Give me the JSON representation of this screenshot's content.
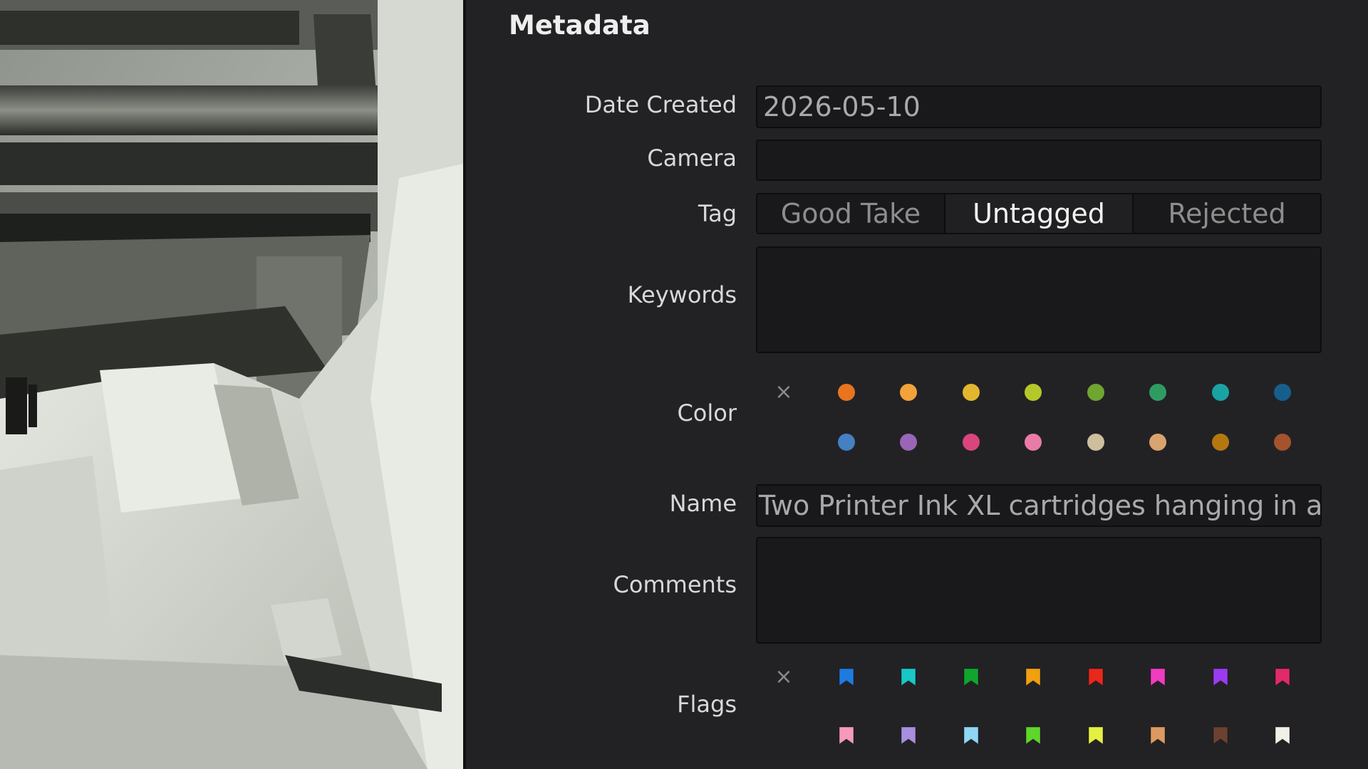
{
  "panel": {
    "title": "Metadata"
  },
  "fields": {
    "date_created": {
      "label": "Date Created",
      "value": "2026-05-10"
    },
    "camera": {
      "label": "Camera",
      "value": ""
    },
    "tag": {
      "label": "Tag",
      "options": [
        "Good Take",
        "Untagged",
        "Rejected"
      ],
      "selected": "Untagged"
    },
    "keywords": {
      "label": "Keywords",
      "value": ""
    },
    "color": {
      "label": "Color",
      "clear_icon": "x-icon",
      "colors": [
        "#e8741f",
        "#f2a23a",
        "#e2b72f",
        "#b5c82a",
        "#6fa530",
        "#2f9b63",
        "#1aa3a3",
        "#165f8c",
        "#4480c2",
        "#9a65b6",
        "#d9457d",
        "#e97ba9",
        "#cdbf9d",
        "#d9a36e",
        "#b5780f",
        "#a4532d"
      ]
    },
    "name": {
      "label": "Name",
      "value": "Two Printer Ink XL cartridges hanging in a p"
    },
    "comments": {
      "label": "Comments",
      "value": ""
    },
    "flags": {
      "label": "Flags",
      "clear_icon": "x-icon",
      "colors": [
        "#1f7ae0",
        "#19c7c7",
        "#11a52e",
        "#f0a010",
        "#e8281a",
        "#f03cc0",
        "#9b3bf0",
        "#e02a6a",
        "#f59ab8",
        "#a88ee0",
        "#8fd6f5",
        "#5ed62a",
        "#e6f043",
        "#dc9a60",
        "#6a4230",
        "#f2efe9"
      ]
    }
  }
}
